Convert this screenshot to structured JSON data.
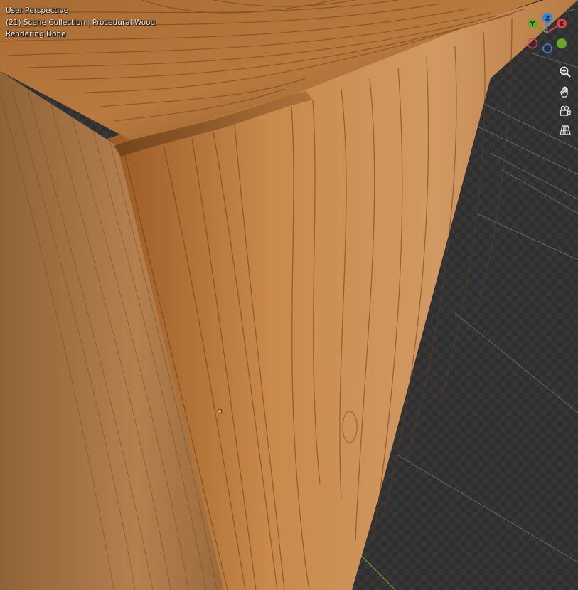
{
  "viewport": {
    "view_name": "User Perspective",
    "frame_collection": "(21) Scene Collection",
    "object_name": "Procedural Wood",
    "status": "Rendering Done"
  },
  "gizmo": {
    "x_label": "X",
    "y_label": "Y",
    "z_label": "Z",
    "x_color": "#e0404f",
    "y_color": "#6aa829",
    "z_color": "#2f83e4"
  },
  "nav_tools": [
    {
      "name": "zoom",
      "icon": "magnifier-plus-icon"
    },
    {
      "name": "pan",
      "icon": "hand-icon"
    },
    {
      "name": "camera-view",
      "icon": "camera-icon"
    },
    {
      "name": "perspective-ortho",
      "icon": "grid-perspective-icon"
    }
  ],
  "colors": {
    "background": "#2f2f2f",
    "wood_light": "#c8874b",
    "wood_dark": "#7a4a20",
    "origin_dot": "#ff9a1c"
  }
}
